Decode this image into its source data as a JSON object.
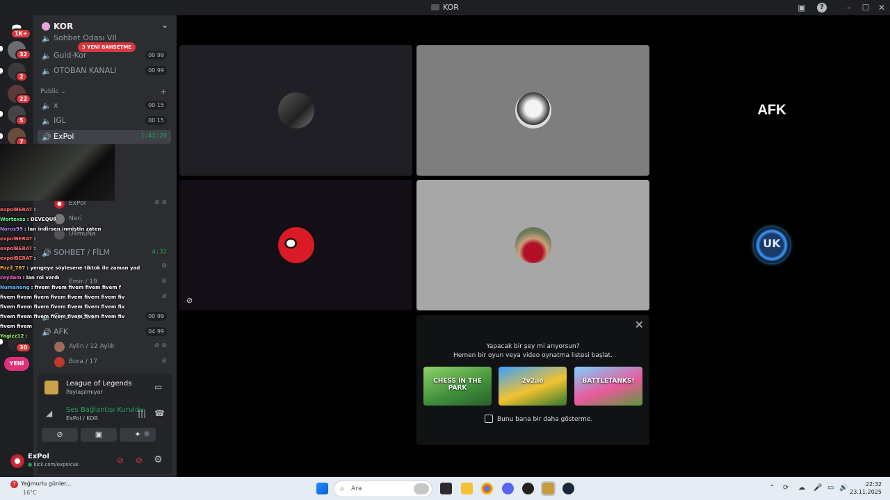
{
  "window": {
    "title": "KOR"
  },
  "rail": {
    "home_badge": "1K+",
    "servers": [
      {
        "badge": "32"
      },
      {
        "badge": "2"
      },
      {
        "badge": "22"
      },
      {
        "badge": "5"
      },
      {
        "badge": "7"
      },
      {
        "badge": ""
      },
      {
        "badge": ""
      },
      {
        "badge": ""
      },
      {
        "badge": ""
      },
      {
        "badge": ""
      },
      {
        "badge": "30"
      }
    ],
    "new_label": "YENİ"
  },
  "server": {
    "name": "KOR",
    "mentions_badge": "3 YENİ BAHSETME"
  },
  "channels": {
    "sohbet_partial": "Sohbet Odası VII",
    "guid": {
      "name": "Guid-Kor",
      "count": "00",
      "max": "99"
    },
    "otoban": {
      "name": "OTOBAN KANALI",
      "count": "00",
      "max": "99"
    },
    "category_public": "Public",
    "x": {
      "name": "x",
      "count": "00",
      "max": "15"
    },
    "igl": {
      "name": "IGL",
      "count": "00",
      "max": "15"
    },
    "expol": {
      "name": "ExPol",
      "timer": "1:42:20"
    },
    "expol_users": [
      "ExPol",
      "Neri",
      "UxmuNa"
    ],
    "sohbet_film": {
      "name": "SOHBET / FİLM",
      "timer": "4:32"
    },
    "film_users": [
      "Emir / 19"
    ],
    "oyun": {
      "name": "Oyun odası",
      "count": "00",
      "max": "99"
    },
    "afk": {
      "name": "AFK",
      "count": "04",
      "max": "99"
    },
    "afk_users": [
      "Aylin / 12 Aylık",
      "Bora / 17"
    ]
  },
  "chat_overlay": [
    {
      "user": "expolBERAT",
      "text": ":",
      "color": "#ff6b6b"
    },
    {
      "user": "Wortexss",
      "text": ": DEVEQUR",
      "color": "#6bff8f"
    },
    {
      "user": "Noros99",
      "text": ": lan indirsen inmiştin zaten",
      "color": "#b58cff"
    },
    {
      "user": "expolBERAT",
      "text": ":",
      "color": "#ff6b6b"
    },
    {
      "user": "expolBERAT",
      "text": ":",
      "color": "#ff6b6b"
    },
    {
      "user": "expolBERAT",
      "text": ":",
      "color": "#ff6b6b"
    },
    {
      "user": "Fozil_767",
      "text": ": yengeye söylesene tiktok ile zaman yad",
      "color": "#ffb347"
    },
    {
      "user": "ceydam",
      "text": ": lan rol vardı",
      "color": "#ff6bd5"
    },
    {
      "user": "Numanong",
      "text": ": fivem fivem fivem fivem fivem f",
      "color": "#6bb8ff"
    },
    {
      "user": "",
      "text": "fivem fivem fivem fivem fivem fivem fivem fiv",
      "color": "#ffffff"
    },
    {
      "user": "",
      "text": "fivem fivem fivem fivem fivem fivem fivem fiv",
      "color": "#ffffff"
    },
    {
      "user": "",
      "text": "fivem fivem fivem fivem fivem fivem fivem fiv",
      "color": "#ffffff"
    },
    {
      "user": "",
      "text": "fivem fivem",
      "color": "#ffffff"
    },
    {
      "user": "Yagizz12",
      "text": ":",
      "color": "#9cff6b"
    }
  ],
  "activity_panel": {
    "game": "League of Legends",
    "game_status": "Paylaşılmıyor",
    "voice_status": "Ses Bağlantısı Kuruldu",
    "voice_channel": "ExPol / KOR"
  },
  "user_panel": {
    "name": "ExPol",
    "status": "kick.com/expolcuk"
  },
  "tiles": {
    "afk_label": "AFK",
    "uk_label": "UK"
  },
  "activity_popup": {
    "line1": "Yapacak bir şey mi arıyorsun?",
    "line2": "Hemen bir oyun veya video oynatma listesi başlat.",
    "games": [
      "CHESS IN THE PARK",
      "2v2.io",
      "BATTLETANKS!"
    ],
    "dont_show": "Bunu bana bir daha gösterme."
  },
  "taskbar": {
    "weather_badge": "7",
    "weather_title": "Yağmurlu günler...",
    "weather_temp": "16°C",
    "search_placeholder": "Ara",
    "time": "22:32",
    "date": "23.11.2025"
  },
  "colors": {
    "accent_green": "#23a559",
    "mention_red": "#da373c",
    "sidebar": "#2b2d31"
  }
}
